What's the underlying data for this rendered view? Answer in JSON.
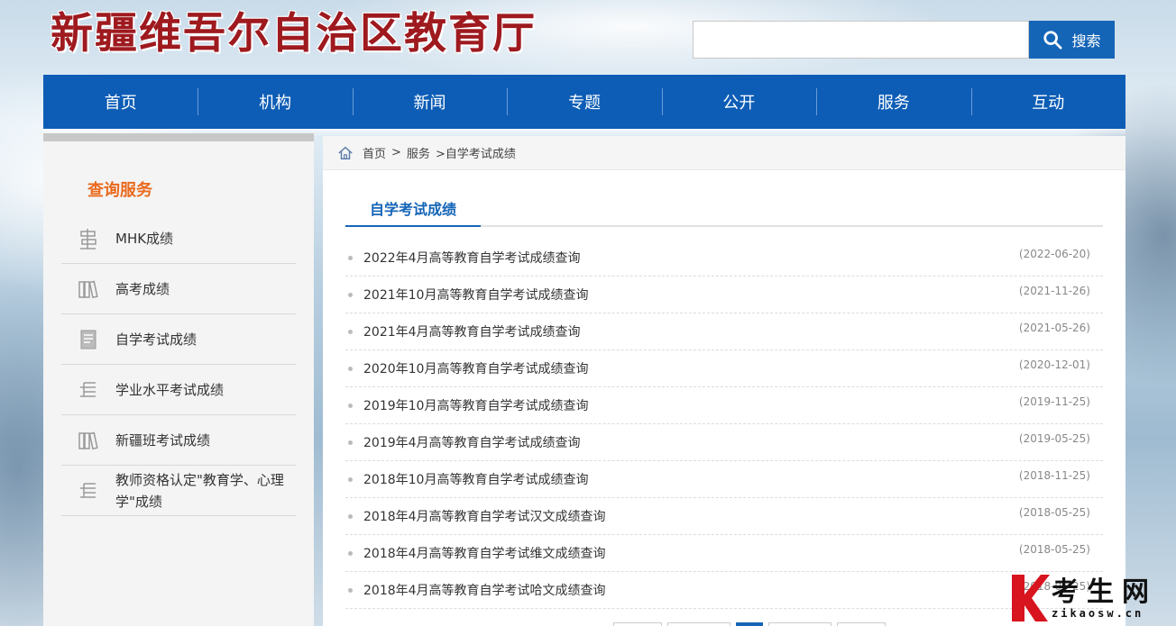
{
  "header": {
    "logo_text": "新疆维吾尔自治区教育厅",
    "search_placeholder": "",
    "search_button_label": "搜索"
  },
  "nav": {
    "items": [
      "首页",
      "机构",
      "新闻",
      "专题",
      "公开",
      "服务",
      "互动"
    ]
  },
  "sidebar": {
    "title": "查询服务",
    "items": [
      {
        "label": "MHK成绩",
        "icon": "signpost-icon"
      },
      {
        "label": "高考成绩",
        "icon": "books-icon"
      },
      {
        "label": "自学考试成绩",
        "icon": "document-icon"
      },
      {
        "label": "学业水平考试成绩",
        "icon": "list-icon"
      },
      {
        "label": "新疆班考试成绩",
        "icon": "books-icon"
      },
      {
        "label": "教师资格认定\"教育学、心理学\"成绩",
        "icon": "list-icon"
      }
    ]
  },
  "breadcrumb": {
    "home": "首页",
    "sep1": ">",
    "level1": "服务",
    "current": ">自学考试成绩"
  },
  "main": {
    "tab_label": "自学考试成绩",
    "articles": [
      {
        "title": "2022年4月高等教育自学考试成绩查询",
        "date": "(2022-06-20)"
      },
      {
        "title": "2021年10月高等教育自学考试成绩查询",
        "date": "(2021-11-26)"
      },
      {
        "title": "2021年4月高等教育自学考试成绩查询",
        "date": "(2021-05-26)"
      },
      {
        "title": "2020年10月高等教育自学考试成绩查询",
        "date": "(2020-12-01)"
      },
      {
        "title": "2019年10月高等教育自学考试成绩查询",
        "date": "(2019-11-25)"
      },
      {
        "title": "2019年4月高等教育自学考试成绩查询",
        "date": "(2019-05-25)"
      },
      {
        "title": "2018年10月高等教育自学考试成绩查询",
        "date": "(2018-11-25)"
      },
      {
        "title": "2018年4月高等教育自学考试汉文成绩查询",
        "date": "(2018-05-25)"
      },
      {
        "title": "2018年4月高等教育自学考试维文成绩查询",
        "date": "(2018-05-25)"
      },
      {
        "title": "2018年4月高等教育自学考试哈文成绩查询",
        "date": "(2018-05-25)"
      }
    ]
  },
  "watermark": {
    "main_text": "考生网",
    "sub_text": "zikaosw.cn"
  },
  "colors": {
    "nav_blue": "#0d5db6",
    "accent_orange": "#ea6a1e",
    "logo_red": "#9e1a1f"
  }
}
